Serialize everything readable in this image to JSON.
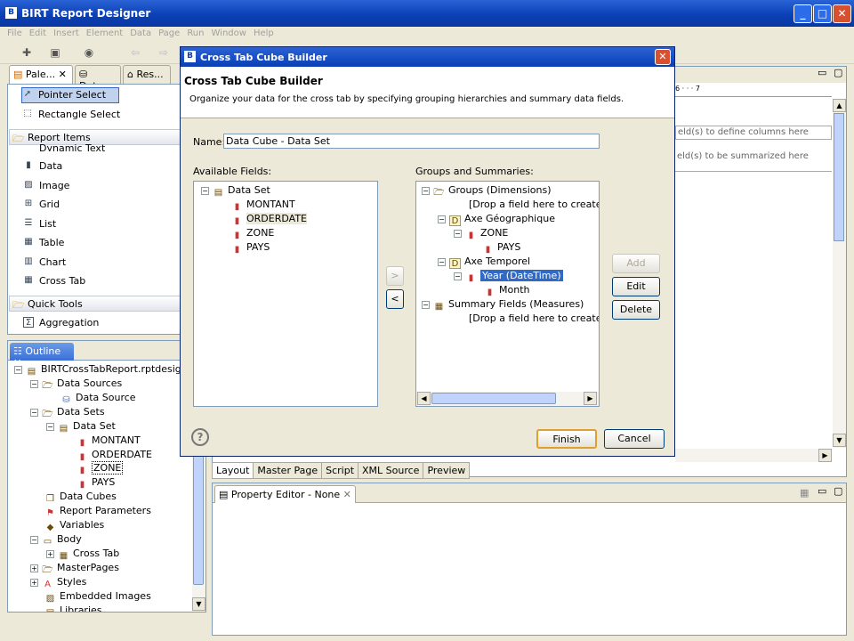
{
  "app": {
    "title": "BIRT Report Designer"
  },
  "menu": [
    "File",
    "Edit",
    "Insert",
    "Element",
    "Data",
    "Page",
    "Run",
    "Window",
    "Help"
  ],
  "views": {
    "tabs": [
      "Pale...",
      "Dat...",
      "Res..."
    ]
  },
  "palette": {
    "items": [
      "Pointer Select",
      "Rectangle Select"
    ],
    "report_items_header": "Report Items",
    "report_items": [
      "Dynamic Text",
      "Data",
      "Image",
      "Grid",
      "List",
      "Table",
      "Chart",
      "Cross Tab"
    ],
    "quick_tools_header": "Quick Tools",
    "quick_tools": [
      "Aggregation"
    ]
  },
  "outline": {
    "tab": "Outline",
    "root": "BIRTCrossTabReport.rptdesign",
    "nodes": [
      "Data Sources",
      "Data Source",
      "Data Sets",
      "Data Set",
      "MONTANT",
      "ORDERDATE",
      "ZONE",
      "PAYS",
      "Data Cubes",
      "Report Parameters",
      "Variables",
      "Body",
      "Cross Tab",
      "MasterPages",
      "Styles",
      "Embedded Images",
      "Libraries"
    ]
  },
  "editor": {
    "ruler": "6 · · · 7",
    "hint_columns": "eld(s) to define columns here",
    "hint_summary": "eld(s) to be summarized here",
    "tabs": [
      "Layout",
      "Master Page",
      "Script",
      "XML Source",
      "Preview"
    ],
    "property_editor": "Property Editor - None"
  },
  "dialog": {
    "window_title": "Cross Tab Cube Builder",
    "heading": "Cross Tab Cube Builder",
    "description": "Organize your data for the cross tab by specifying grouping hierarchies and summary data fields.",
    "name_label": "Name:",
    "name_value": "Data Cube - Data Set",
    "available_label": "Available Fields:",
    "available_root": "Data Set",
    "available_fields": [
      "MONTANT",
      "ORDERDATE",
      "ZONE",
      "PAYS"
    ],
    "groups_label": "Groups and Summaries:",
    "groups_tree": {
      "groups": "Groups (Dimensions)",
      "drop_group": "[Drop a field here to create a grou",
      "geo": "Axe Géographique",
      "zone": "ZONE",
      "pays": "PAYS",
      "temporel": "Axe Temporel",
      "year": "Year (DateTime)",
      "month": "Month",
      "summary": "Summary Fields (Measures)",
      "drop_summary": "[Drop a field here to create a sumr"
    },
    "buttons": {
      "add": "Add",
      "edit": "Edit",
      "delete": "Delete",
      "finish": "Finish",
      "cancel": "Cancel",
      "right": ">",
      "left": "<",
      "help": "?"
    }
  }
}
